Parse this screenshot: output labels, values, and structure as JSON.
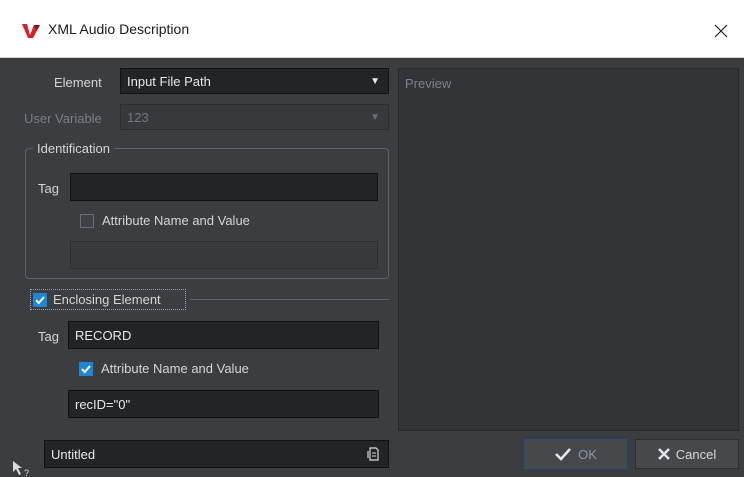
{
  "window": {
    "title": "XML Audio Description"
  },
  "form": {
    "element_label": "Element",
    "element_value": "Input File Path",
    "user_variable_label": "User Variable",
    "user_variable_value": "123"
  },
  "identification": {
    "title": "Identification",
    "tag_label": "Tag",
    "tag_value": "",
    "attribute_checkbox_label": "Attribute Name and Value",
    "attribute_checked": false,
    "attribute_value": ""
  },
  "enclosing": {
    "checkbox_label": "Enclosing Element",
    "checked": true,
    "tag_label": "Tag",
    "tag_value": "RECORD",
    "attribute_checkbox_label": "Attribute Name and Value",
    "attribute_checked": true,
    "attribute_value": "recID=\"0\""
  },
  "preview": {
    "label": "Preview"
  },
  "preset": {
    "name": "Untitled",
    "icon": "preset-menu-icon"
  },
  "buttons": {
    "ok_label": "OK",
    "cancel_label": "Cancel"
  },
  "colors": {
    "accent": "#1e86d6",
    "background": "#3b3d40",
    "field": "#232427"
  }
}
